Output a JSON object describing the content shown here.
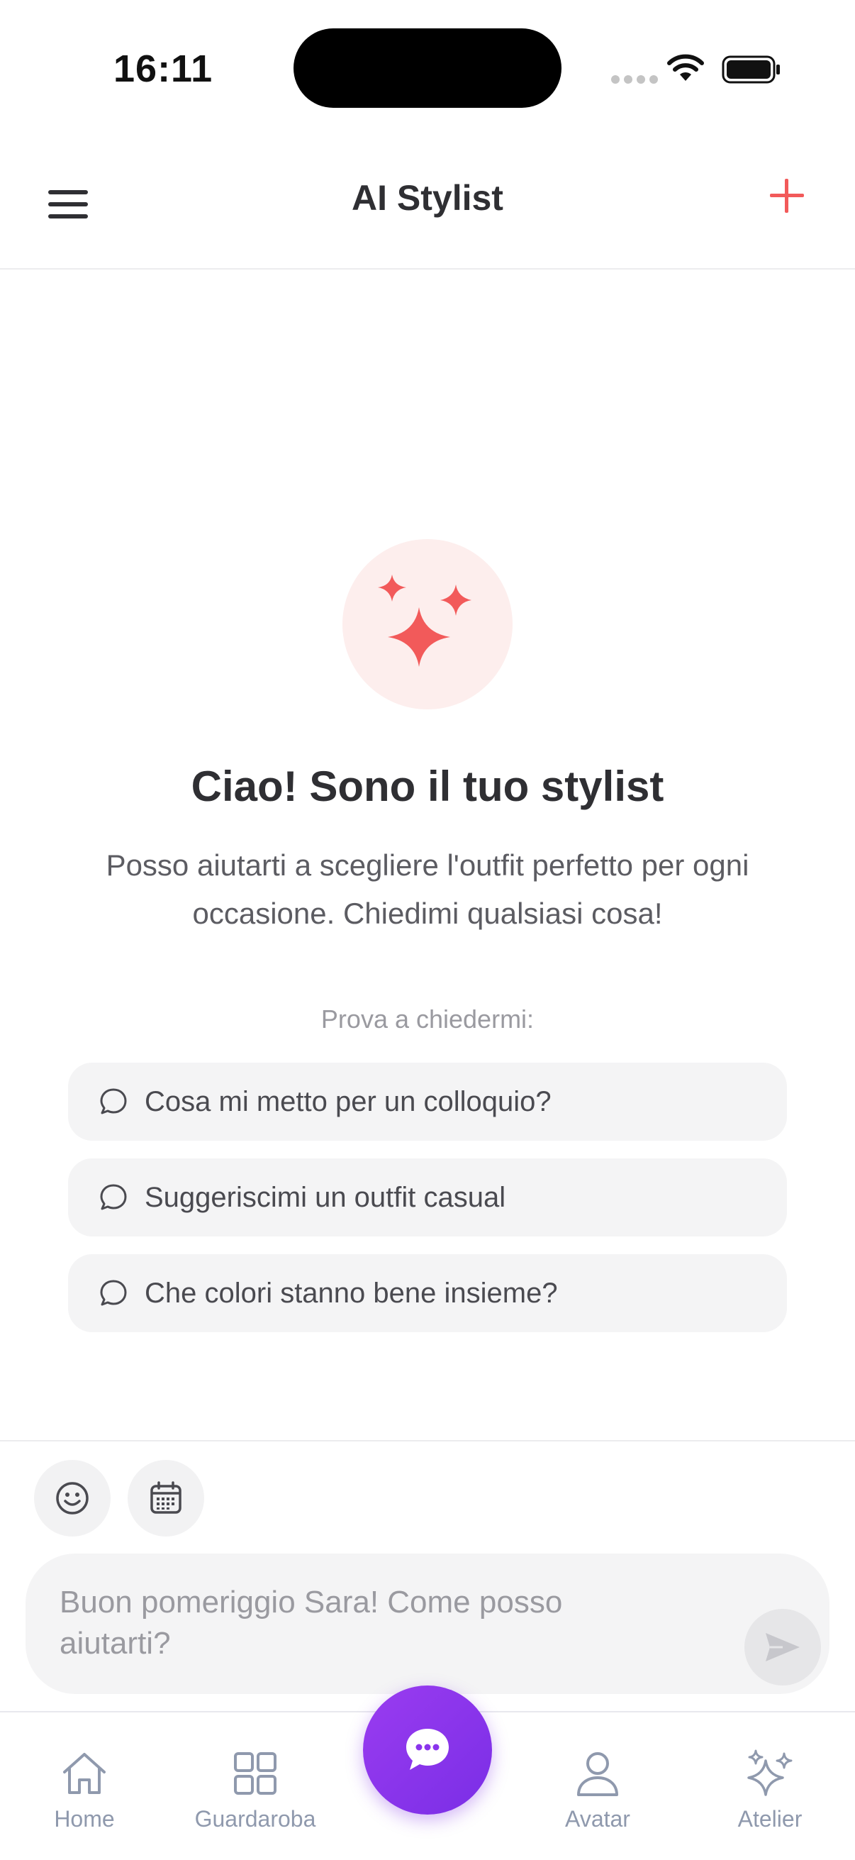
{
  "status_bar": {
    "time": "16:11"
  },
  "header": {
    "title": "AI Stylist",
    "menu_icon": "hamburger-icon",
    "add_icon": "plus-icon"
  },
  "hero": {
    "icon": "sparkles-icon",
    "title": "Ciao! Sono il tuo stylist",
    "subtitle": "Posso aiutarti a scegliere l'outfit perfetto per ogni occasione. Chiedimi qualsiasi cosa!"
  },
  "suggestions": {
    "label": "Prova a chiedermi:",
    "items": [
      {
        "label": "Cosa mi metto per un colloquio?"
      },
      {
        "label": "Suggeriscimi un outfit casual"
      },
      {
        "label": "Che colori stanno bene insieme?"
      }
    ]
  },
  "composer": {
    "placeholder": "Buon pomeriggio Sara! Come posso aiutarti?",
    "emoji_icon": "smiley-icon",
    "calendar_icon": "calendar-icon",
    "send_icon": "send-icon"
  },
  "tab_bar": {
    "tabs": [
      {
        "label": "Home",
        "icon": "home-icon"
      },
      {
        "label": "Guardaroba",
        "icon": "grid-icon"
      },
      {
        "label": "Avatar",
        "icon": "person-icon"
      },
      {
        "label": "Atelier",
        "icon": "sparkles-icon"
      }
    ],
    "center_icon": "chat-bubble-icon"
  },
  "colors": {
    "accent": "#f25a5a",
    "fab": "#8a35ec",
    "tab_inactive": "#8f99ad"
  }
}
